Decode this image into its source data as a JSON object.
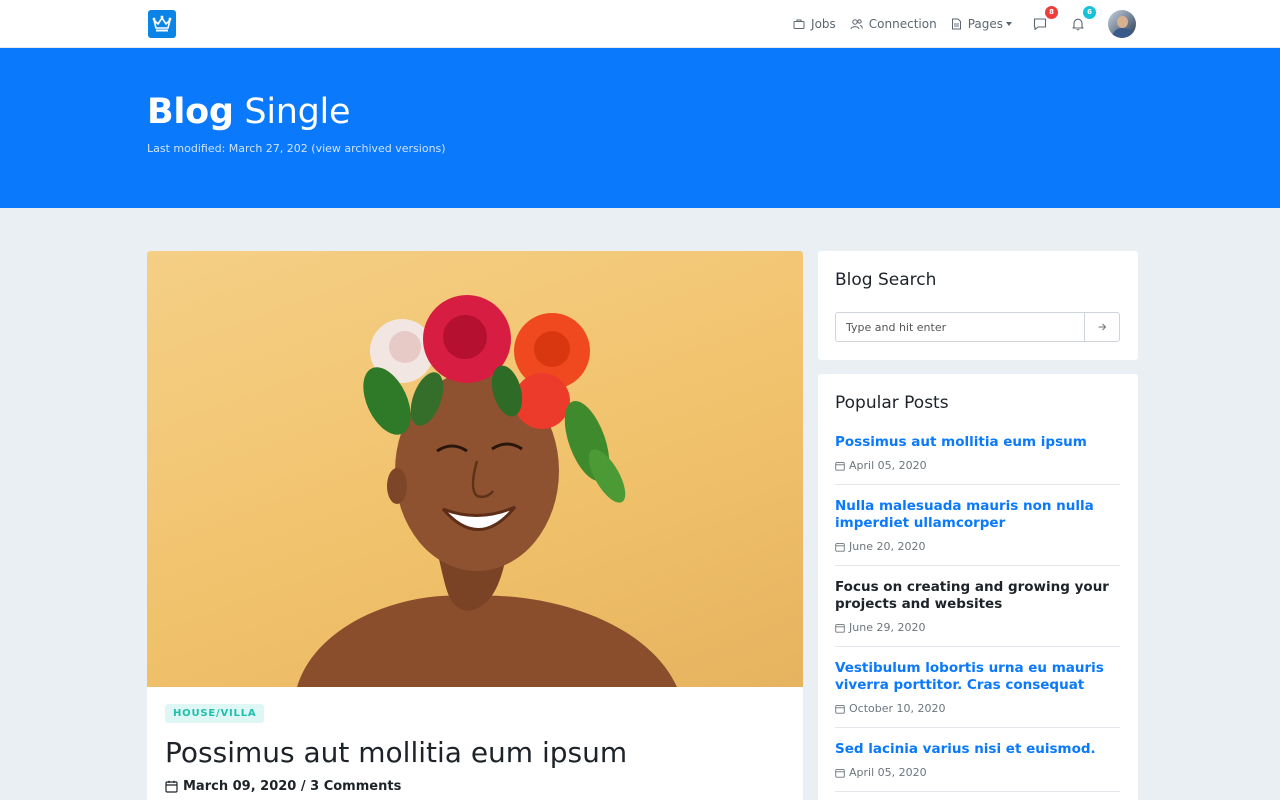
{
  "nav": {
    "jobs": "Jobs",
    "connection": "Connection",
    "pages": "Pages",
    "messages_badge": "8",
    "notifications_badge": "6"
  },
  "hero": {
    "title_bold": "Blog",
    "title_light": "Single",
    "subtitle": "Last modified: March 27, 202 (view archived versions)"
  },
  "post": {
    "tag": "HOUSE/VILLA",
    "title": "Possimus aut mollitia eum ipsum",
    "meta": "March 09, 2020 / 3 Comments"
  },
  "search": {
    "title": "Blog Search",
    "placeholder": "Type and hit enter"
  },
  "popular": {
    "title": "Popular Posts",
    "items": [
      {
        "title": "Possimus aut mollitia eum ipsum",
        "date": "April 05, 2020"
      },
      {
        "title": "Nulla malesuada mauris non nulla imperdiet ullamcorper",
        "date": "June 20, 2020"
      },
      {
        "title": "Focus on creating and growing your projects and websites",
        "date": "June 29, 2020"
      },
      {
        "title": "Vestibulum lobortis urna eu mauris viverra porttitor. Cras consequat",
        "date": "October 10, 2020"
      },
      {
        "title": "Sed lacinia varius nisi et euismod.",
        "date": "April 05, 2020"
      }
    ]
  },
  "colors": {
    "primary": "#0a79fb",
    "hero_bg": "#0a79fb",
    "page_bg": "#eaeff4",
    "tag_bg": "#dff7f4",
    "tag_text": "#1fbfae"
  }
}
